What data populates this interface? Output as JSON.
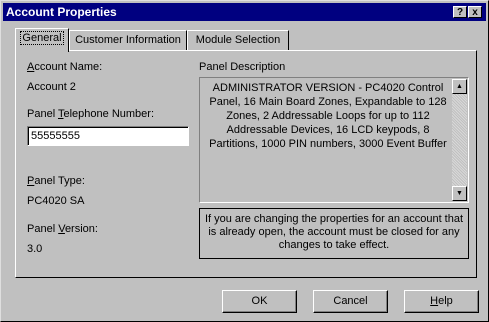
{
  "window": {
    "title": "Account Properties",
    "help_glyph": "?",
    "close_glyph": "x"
  },
  "tabs": [
    {
      "label": "General",
      "active": true
    },
    {
      "label": "Customer Information",
      "active": false
    },
    {
      "label": "Module Selection",
      "active": false
    }
  ],
  "general": {
    "account_name_label_pre": "",
    "account_name_label_key": "A",
    "account_name_label_post": "ccount Name:",
    "account_name_value": "Account 2",
    "phone_label_pre": "Panel ",
    "phone_label_key": "T",
    "phone_label_post": "elephone Number:",
    "phone_value": "55555555",
    "panel_type_label_pre": "",
    "panel_type_label_key": "P",
    "panel_type_label_post": "anel Type:",
    "panel_type_value": "PC4020 SA",
    "panel_version_label_pre": "Panel ",
    "panel_version_label_key": "V",
    "panel_version_label_post": "ersion:",
    "panel_version_value": "3.0",
    "description_label": "Panel Description",
    "description_text": "ADMINISTRATOR VERSION - PC4020 Control Panel, 16 Main Board Zones, Expandable to 128 Zones, 2 Addressable Loops for up to 112 Addressable Devices, 16 LCD keypods, 8 Partitions, 1000 PIN numbers, 3000 Event Buffer",
    "notice_text": "If you are changing the properties for an account that is already open, the account must be closed for any changes to take effect."
  },
  "buttons": {
    "ok": "OK",
    "cancel": "Cancel",
    "help_key": "H",
    "help_rest": "elp"
  }
}
